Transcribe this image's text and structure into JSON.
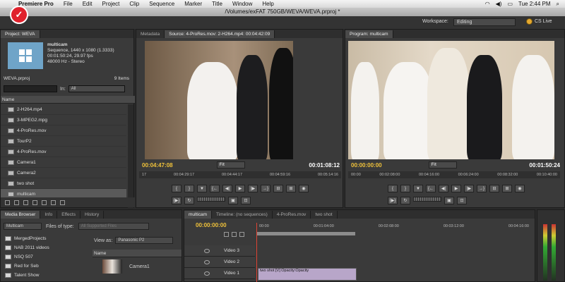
{
  "menubar": {
    "app_name": "Premiere Pro",
    "items": [
      "File",
      "Edit",
      "Project",
      "Clip",
      "Sequence",
      "Marker",
      "Title",
      "Window",
      "Help"
    ],
    "clock": "Tue 2:44 PM"
  },
  "window_title": "/Volumes/exFAT 750GB/WEVA/WEVA.prproj *",
  "workspace": {
    "label": "Workspace:",
    "value": "Editing",
    "cs_live": "CS Live"
  },
  "project": {
    "tab": "Project: WEVA",
    "clip_name": "multicam",
    "clip_info": [
      "Sequence, 1440 x 1080 (1.3333)",
      "00:01:50:24, 29.97 fps",
      "48000 Hz - Stereo"
    ],
    "file": "WEVA.prproj",
    "item_count": "9 Items",
    "in_label": "In:",
    "in_value": "All",
    "name_header": "Name",
    "items": [
      "2-H264.mp4",
      "3-MPEG2.mpg",
      "4-ProRes.mov",
      "TourP2",
      "4-ProRes.mov",
      "Camera1",
      "Camera2",
      "two shot",
      "multicam"
    ]
  },
  "source_monitor": {
    "tabs": [
      "Metadata",
      "Source: 4-ProRes.mov: 2-H264.mp4: 00:04:42:09"
    ],
    "timecode_in": "00:04:47:08",
    "timecode_dur": "00:01:08:12",
    "fit": "Fit",
    "ruler": [
      "17",
      "00:04:29:17",
      "00:04:44:17",
      "00:04:59:16",
      "00:05:14:16"
    ]
  },
  "program_monitor": {
    "tabs": [
      "Program: multicam"
    ],
    "timecode_in": "00:00:00:00",
    "timecode_dur": "00:01:50:24",
    "fit": "Fit",
    "ruler": [
      "00:00",
      "00:02:08:00",
      "00:04:16:00",
      "00:06:24:00",
      "00:08:32:00",
      "00:10:40:00"
    ]
  },
  "media_browser": {
    "tabs": [
      "Media Browser",
      "Info",
      "Effects",
      "History"
    ],
    "drive": "Multicam",
    "files_of_type_label": "Files of type:",
    "files_of_type_value": "All Supported Files",
    "view_as_label": "View as:",
    "view_as_value": "Panasonic P2",
    "name_header": "Name",
    "folders": [
      "MergedProjects",
      "NAB 2011 videos",
      "NSQ 507",
      "Red for Seb",
      "Talent Show",
      "TheVolumeSettingsFolder"
    ],
    "clips": [
      "Camera1"
    ]
  },
  "timeline": {
    "tabs": [
      "multicam",
      "Timeline: (no sequences)",
      "4-ProRes.mov",
      "two shot"
    ],
    "timecode": "00:00:00:00",
    "ruler": [
      "00:00",
      "00:01:04:00",
      "00:02:08:00",
      "00:03:12:00",
      "00:04:16:00"
    ],
    "tracks": [
      "Video 3",
      "Video 2",
      "Video 1"
    ],
    "clip_label": "two shot [V] Opacity:Opacity"
  }
}
